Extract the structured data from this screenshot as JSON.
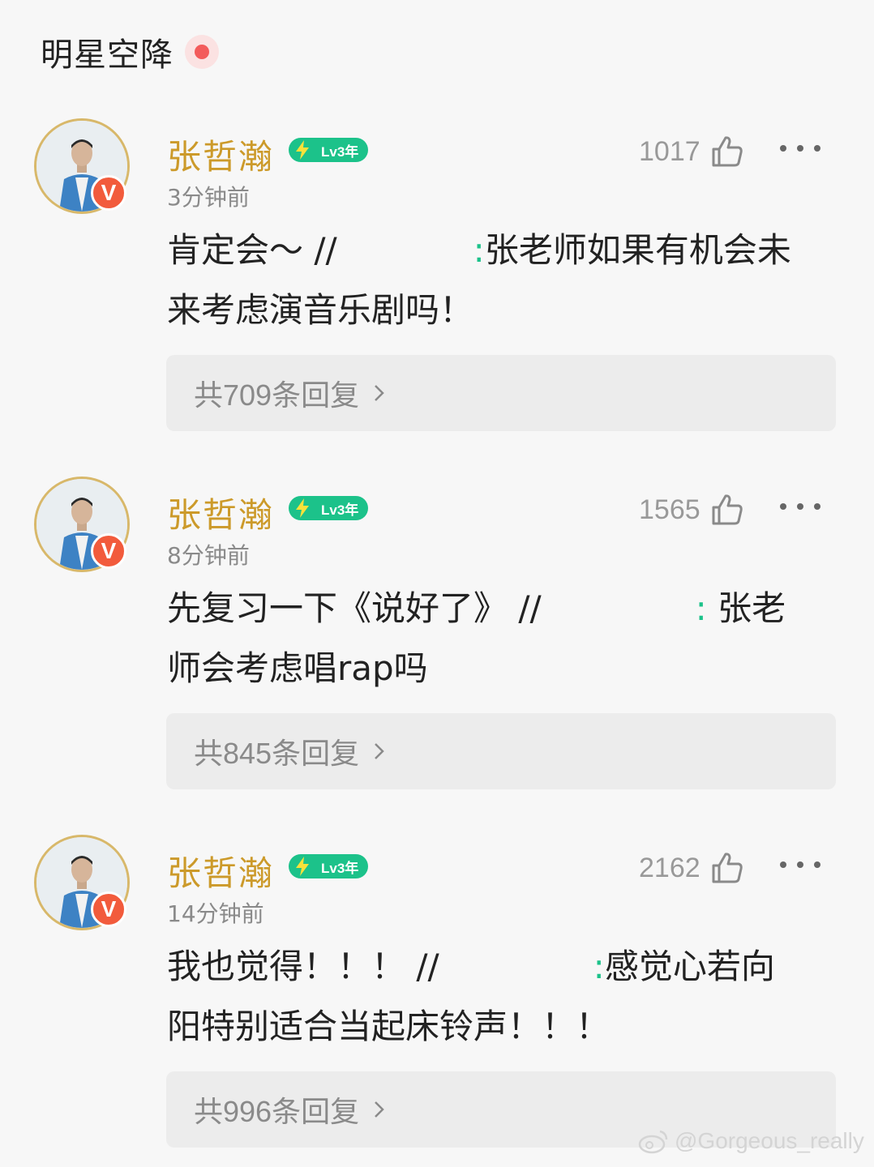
{
  "section": {
    "title": "明星空降"
  },
  "comments": [
    {
      "username": "张哲瀚",
      "level": "Lv3年",
      "verified_mark": "V",
      "time": "3分钟前",
      "likes": "1017",
      "text_line1_a": "肯定会～ //",
      "text_line1_b": "张老师如果有机会未",
      "text_line2": "来考虑演音乐剧吗！",
      "colon": ":",
      "replies": "共709条回复"
    },
    {
      "username": "张哲瀚",
      "level": "Lv3年",
      "verified_mark": "V",
      "time": "8分钟前",
      "likes": "1565",
      "text_line1_a": "先复习一下《说好了》 //",
      "text_line1_b": "张老",
      "text_line2": "师会考虑唱rap吗",
      "colon": ":",
      "replies": "共845条回复"
    },
    {
      "username": "张哲瀚",
      "level": "Lv3年",
      "verified_mark": "V",
      "time": "14分钟前",
      "likes": "2162",
      "text_line1_a": "我也觉得！！！ //",
      "text_line1_b": "感觉心若向",
      "text_line2": "阳特别适合当起床铃声！！！",
      "colon": ":",
      "replies": "共996条回复"
    }
  ],
  "watermark": {
    "text": "@Gorgeous_really"
  },
  "colors": {
    "username": "#cc9a2a",
    "level_badge": "#1cc28a",
    "verified": "#f25b3c",
    "live_dot": "#f35b5b"
  },
  "icons": {
    "like": "thumbs-up-icon",
    "more": "more-icon",
    "chevron": "chevron-right-icon",
    "bolt": "lightning-icon"
  }
}
